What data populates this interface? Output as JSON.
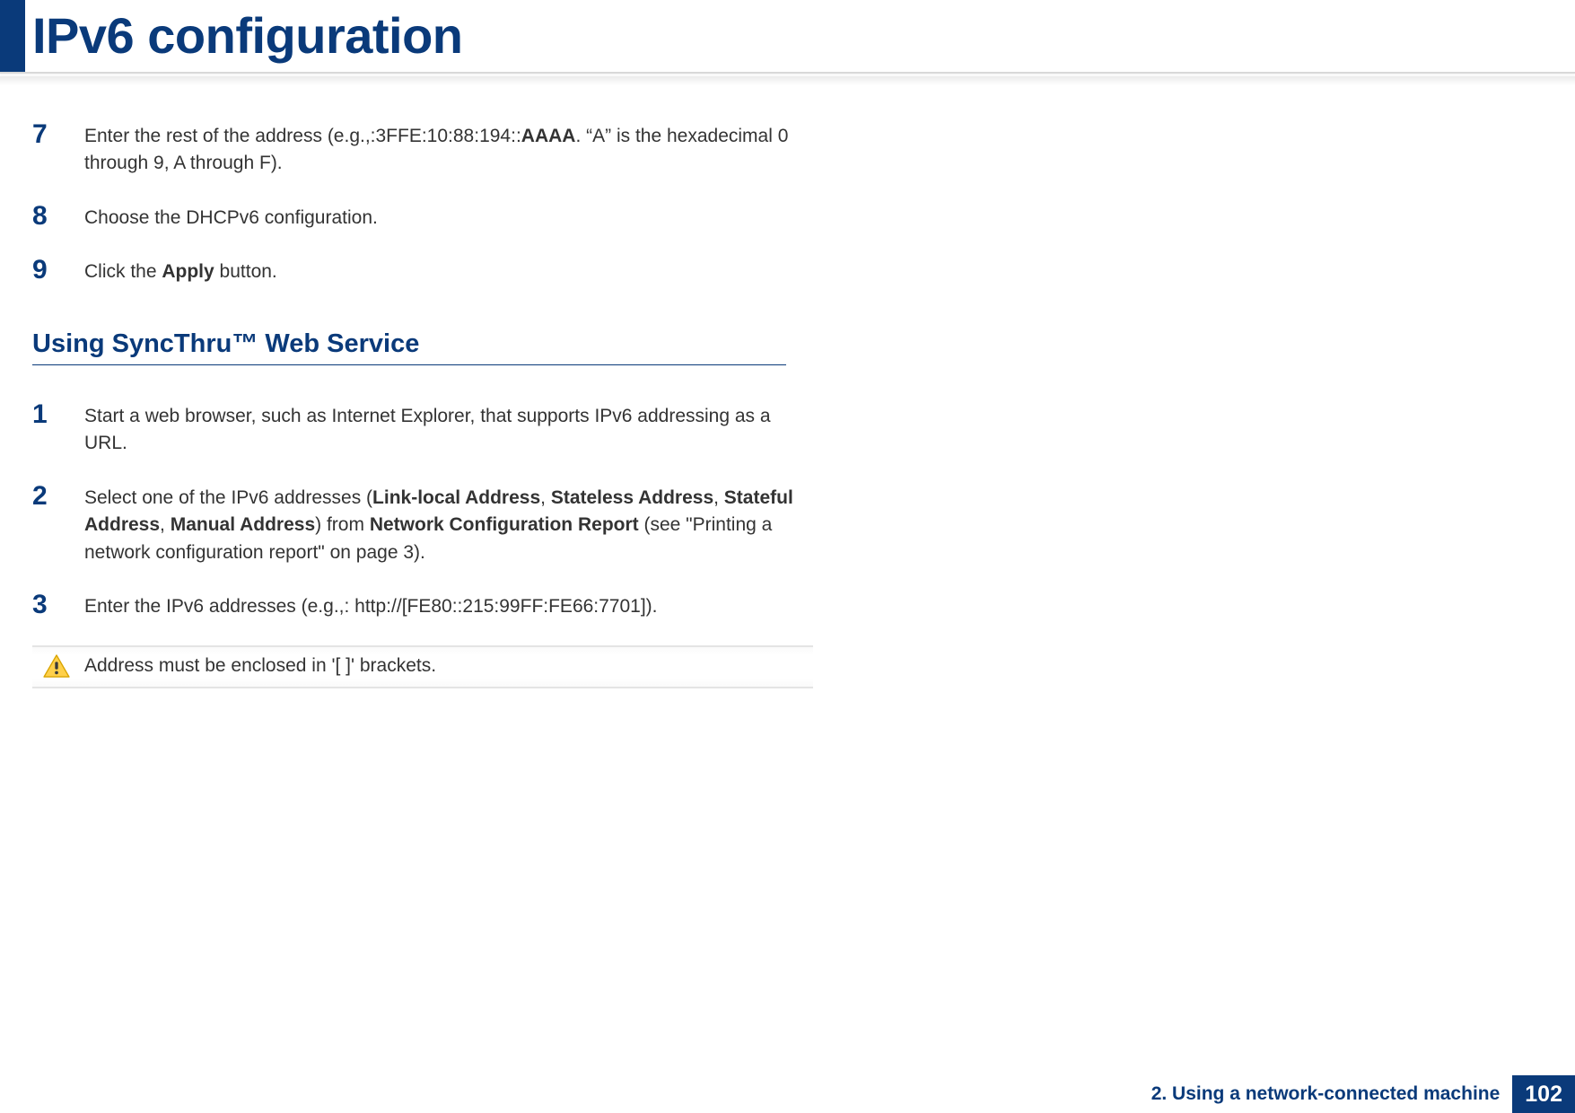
{
  "title": "IPv6 configuration",
  "steps_top": [
    {
      "num": "7",
      "parts": [
        {
          "t": "Enter the rest of the address (e.g.,:3FFE:10:88:194::",
          "b": false
        },
        {
          "t": "AAAA",
          "b": true
        },
        {
          "t": ". “A” is the hexadecimal 0 through 9, A through F).",
          "b": false
        }
      ]
    },
    {
      "num": "8",
      "parts": [
        {
          "t": "Choose the DHCPv6 configuration.",
          "b": false
        }
      ]
    },
    {
      "num": "9",
      "parts": [
        {
          "t": "Click the ",
          "b": false
        },
        {
          "t": "Apply",
          "b": true
        },
        {
          "t": " button.",
          "b": false
        }
      ]
    }
  ],
  "subheading": "Using SyncThru™ Web Service",
  "steps_bottom": [
    {
      "num": "1",
      "parts": [
        {
          "t": "Start a web browser, such as Internet Explorer, that supports IPv6 addressing as a URL.",
          "b": false
        }
      ]
    },
    {
      "num": "2",
      "parts": [
        {
          "t": "Select one of the IPv6 addresses (",
          "b": false
        },
        {
          "t": "Link-local Address",
          "b": true
        },
        {
          "t": ", ",
          "b": false
        },
        {
          "t": "Stateless Address",
          "b": true
        },
        {
          "t": ", ",
          "b": false
        },
        {
          "t": "Stateful Address",
          "b": true
        },
        {
          "t": ", ",
          "b": false
        },
        {
          "t": "Manual Address",
          "b": true
        },
        {
          "t": ") from ",
          "b": false
        },
        {
          "t": "Network Configuration Report",
          "b": true
        },
        {
          "t": " (see \"Printing a network configuration report\" on page 3).",
          "b": false
        }
      ]
    },
    {
      "num": "3",
      "parts": [
        {
          "t": "Enter the IPv6 addresses (e.g.,: http://[FE80::215:99FF:FE66:7701]).",
          "b": false
        }
      ]
    }
  ],
  "note": "Address must be enclosed in '[ ]' brackets.",
  "footer_chapter": "2. Using a network-connected machine",
  "footer_page": "102"
}
